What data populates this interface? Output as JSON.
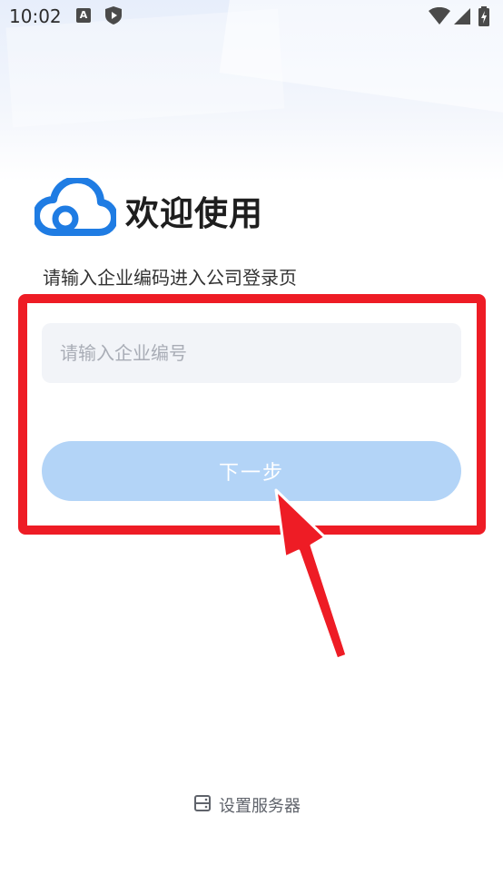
{
  "status_bar": {
    "time": "10:02",
    "icons": [
      "a-icon",
      "shield-play-icon",
      "wifi-icon",
      "signal-icon",
      "battery-charging-icon"
    ]
  },
  "header": {
    "logo": "cloud-logo",
    "title": "欢迎使用",
    "subtitle": "请输入企业编码进入公司登录页"
  },
  "form": {
    "company_code_input": {
      "value": "",
      "placeholder": "请输入企业编号"
    },
    "next_button_label": "下一步"
  },
  "footer": {
    "server_link_label": "设置服务器",
    "server_icon": "server-icon"
  },
  "colors": {
    "brand_blue": "#1f7ce3",
    "button_disabled": "#b3d4f7",
    "annotation_red": "#ee1c25"
  }
}
